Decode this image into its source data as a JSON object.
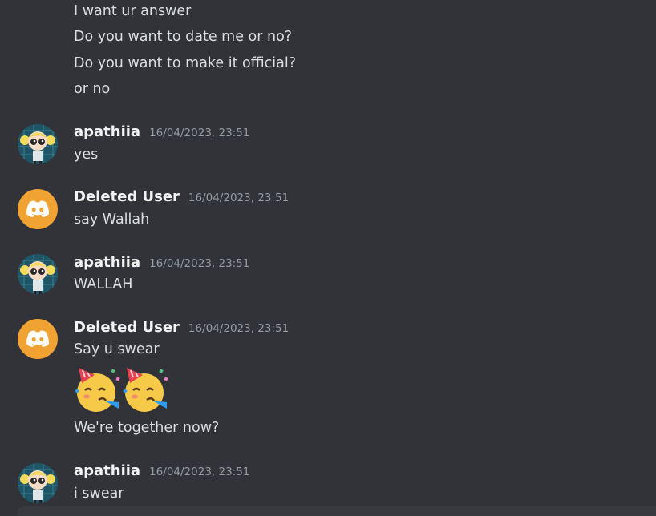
{
  "top_messages": [
    "I want ur answer",
    "Do you want to date me or no?",
    "Do you want to make it official?",
    "or no"
  ],
  "messages": [
    {
      "user": "apathiia",
      "time": "16/04/2023, 23:51",
      "lines": [
        "yes"
      ],
      "avatar": "powerpuff-avatar"
    },
    {
      "user": "Deleted User",
      "time": "16/04/2023, 23:51",
      "lines": [
        "say Wallah"
      ],
      "avatar": "discord-logo-icon"
    },
    {
      "user": "apathiia",
      "time": "16/04/2023, 23:51",
      "lines": [
        "WALLAH"
      ],
      "avatar": "powerpuff-avatar"
    },
    {
      "user": "Deleted User",
      "time": "16/04/2023, 23:51",
      "lines": [
        "Say u swear",
        "We're together now?"
      ],
      "emojis": [
        "partying-face-emoji",
        "partying-face-emoji"
      ],
      "avatar": "discord-logo-icon"
    },
    {
      "user": "apathiia",
      "time": "16/04/2023, 23:51",
      "lines": [
        "i swear"
      ],
      "avatar": "powerpuff-avatar"
    }
  ],
  "colors": {
    "background": "#313338",
    "text": "#dbdee1",
    "username": "#f2f3f5",
    "timestamp": "#949ba4",
    "deleted_avatar": "#f0a232"
  }
}
